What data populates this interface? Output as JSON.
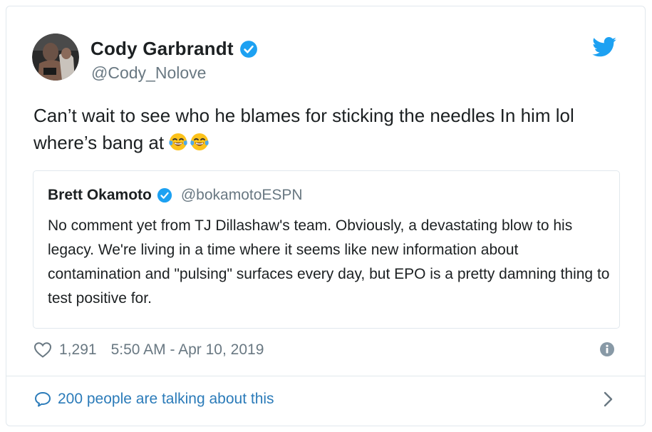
{
  "tweet": {
    "author_name": "Cody Garbrandt",
    "author_handle": "@Cody_Nolove",
    "text": "Can’t wait to see who he blames for sticking the needles In him lol where’s bang at",
    "emojis": [
      "face-with-tears-of-joy",
      "face-with-tears-of-joy"
    ],
    "likes": "1,291",
    "timestamp": "5:50 AM - Apr 10, 2019"
  },
  "quoted_tweet": {
    "author_name": "Brett Okamoto",
    "author_handle": "@bokamotoESPN",
    "text": "No comment yet from TJ Dillashaw's team. Obviously, a devastating blow to his legacy. We're living in a time where it seems like new information about contamination and \"pulsing\" surfaces every day, but EPO is a pretty damning thing to test positive for."
  },
  "conversation": {
    "label": "200 people are talking about this"
  },
  "colors": {
    "twitter_blue": "#1da1f2",
    "verified_blue": "#1da1f2",
    "link_blue": "#2b7bb9",
    "secondary_text": "#697882",
    "border": "#e1e8ed"
  },
  "icons": [
    "avatar",
    "verified-badge-icon",
    "twitter-bird-icon",
    "heart-icon",
    "info-icon",
    "speech-bubble-icon",
    "chevron-right-icon"
  ]
}
